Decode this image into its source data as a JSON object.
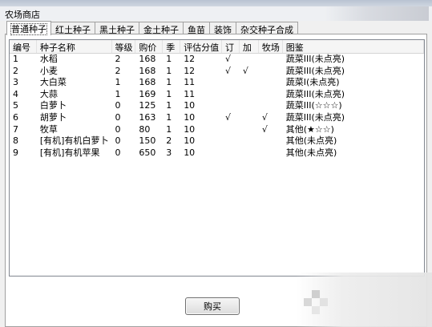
{
  "window": {
    "title": "农场商店"
  },
  "tabs": [
    {
      "label": "普通种子"
    },
    {
      "label": "红土种子"
    },
    {
      "label": "黑土种子"
    },
    {
      "label": "金土种子"
    },
    {
      "label": "鱼苗"
    },
    {
      "label": "装饰"
    },
    {
      "label": "杂交种子合成"
    }
  ],
  "table": {
    "columns": [
      "编号",
      "种子名称",
      "等级",
      "购价",
      "季",
      "评估分值",
      "订",
      "加",
      "牧场",
      "图鉴"
    ],
    "rows": [
      [
        "1",
        "水稻",
        "2",
        "168",
        "1",
        "12",
        "√",
        "",
        "",
        "蔬菜III(未点亮)"
      ],
      [
        "2",
        "小麦",
        "2",
        "168",
        "1",
        "12",
        "√",
        "√",
        "",
        "蔬菜III(未点亮)"
      ],
      [
        "3",
        "大白菜",
        "1",
        "168",
        "1",
        "11",
        "",
        "",
        "",
        "蔬菜Ⅰ(未点亮)"
      ],
      [
        "4",
        "大蒜",
        "1",
        "169",
        "1",
        "11",
        "",
        "",
        "",
        "蔬菜III(未点亮)"
      ],
      [
        "5",
        "白萝卜",
        "0",
        "125",
        "1",
        "10",
        "",
        "",
        "",
        "蔬菜III(☆☆☆)"
      ],
      [
        "6",
        "胡萝卜",
        "0",
        "163",
        "1",
        "10",
        "√",
        "",
        "√",
        "蔬菜III(未点亮)"
      ],
      [
        "7",
        "牧草",
        "0",
        "80",
        "1",
        "10",
        "",
        "",
        "√",
        "其他(★☆☆)"
      ],
      [
        "8",
        "[有机]有机白萝卜",
        "0",
        "150",
        "2",
        "10",
        "",
        "",
        "",
        "其他(未点亮)"
      ],
      [
        "9",
        "[有机]有机苹果",
        "0",
        "650",
        "3",
        "10",
        "",
        "",
        "",
        "其他(未点亮)"
      ]
    ]
  },
  "buttons": {
    "buy": "购买"
  }
}
